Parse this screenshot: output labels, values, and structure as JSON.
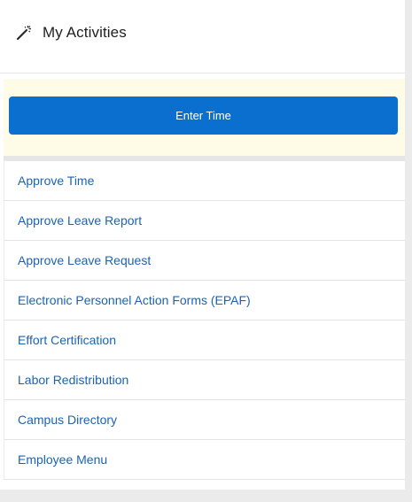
{
  "header": {
    "title": "My Activities",
    "icon": "magic-wand-icon"
  },
  "action": {
    "button_label": "Enter Time",
    "band_color": "#fefbe6",
    "button_color": "#0b6fcf"
  },
  "menu": {
    "items": [
      {
        "label": "Approve Time"
      },
      {
        "label": "Approve Leave Report"
      },
      {
        "label": "Approve Leave Request"
      },
      {
        "label": "Electronic Personnel Action Forms (EPAF)"
      },
      {
        "label": "Effort Certification"
      },
      {
        "label": "Labor Redistribution"
      },
      {
        "label": "Campus Directory"
      },
      {
        "label": "Employee Menu"
      }
    ],
    "link_color": "#1a63b5"
  }
}
